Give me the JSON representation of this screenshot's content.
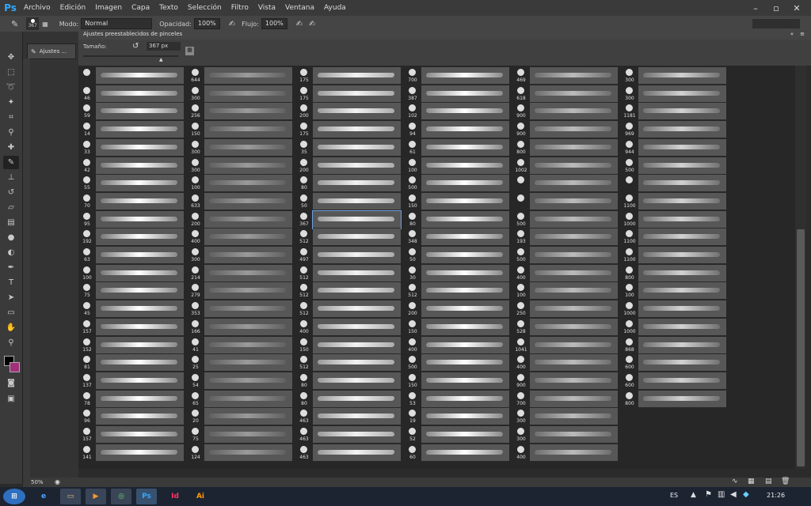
{
  "app": {
    "logo": "Ps"
  },
  "menu": [
    "Archivo",
    "Edición",
    "Imagen",
    "Capa",
    "Texto",
    "Selección",
    "Filtro",
    "Vista",
    "Ventana",
    "Ayuda"
  ],
  "options": {
    "brush_size": "367",
    "mode_label": "Modo:",
    "mode_value": "Normal",
    "opacity_label": "Opacidad:",
    "opacity_value": "100%",
    "flow_label": "Flujo:",
    "flow_value": "100%"
  },
  "dock": {
    "tab_label": "Ajustes ..."
  },
  "panel": {
    "title": "Ajustes preestablecidos de pinceles",
    "size_label": "Tamaño:",
    "size_value": "367 px"
  },
  "status": {
    "zoom": "50%"
  },
  "taskbar": {
    "lang": "ES",
    "time": "21:26"
  },
  "columns": [
    {
      "nums": [
        "",
        "46",
        "59",
        "14",
        "33",
        "42",
        "55",
        "70",
        "95",
        "192",
        "63",
        "100",
        "75",
        "45",
        "157",
        "152",
        "81",
        "137",
        "78",
        "96",
        "157",
        "141"
      ]
    },
    {
      "nums": [
        "644",
        "300",
        "256",
        "150",
        "300",
        "300",
        "100",
        "633",
        "200",
        "400",
        "300",
        "214",
        "279",
        "353",
        "166",
        "41",
        "25",
        "54",
        "65",
        "20",
        "75",
        "124"
      ]
    },
    {
      "nums": [
        "175",
        "175",
        "200",
        "175",
        "35",
        "200",
        "80",
        "50",
        "367",
        "512",
        "497",
        "512",
        "512",
        "512",
        "400",
        "150",
        "512",
        "80",
        "80",
        "463",
        "463",
        "463"
      ]
    },
    {
      "nums": [
        "700",
        "387",
        "102",
        "94",
        "61",
        "100",
        "500",
        "150",
        "80",
        "348",
        "50",
        "30",
        "512",
        "200",
        "150",
        "400",
        "500",
        "150",
        "53",
        "19",
        "52",
        "60",
        "36"
      ]
    },
    {
      "nums": [
        "469",
        "618",
        "900",
        "900",
        "800",
        "1002",
        "",
        "",
        "500",
        "193",
        "500",
        "400",
        "100",
        "250",
        "528",
        "1041",
        "400",
        "900",
        "700",
        "300",
        "300",
        "400"
      ]
    },
    {
      "nums": [
        "300",
        "300",
        "1181",
        "969",
        "944",
        "500",
        "",
        "1100",
        "1000",
        "1100",
        "1100",
        "800",
        "100",
        "1000",
        "1000",
        "868",
        "600",
        "600",
        "800"
      ]
    }
  ]
}
